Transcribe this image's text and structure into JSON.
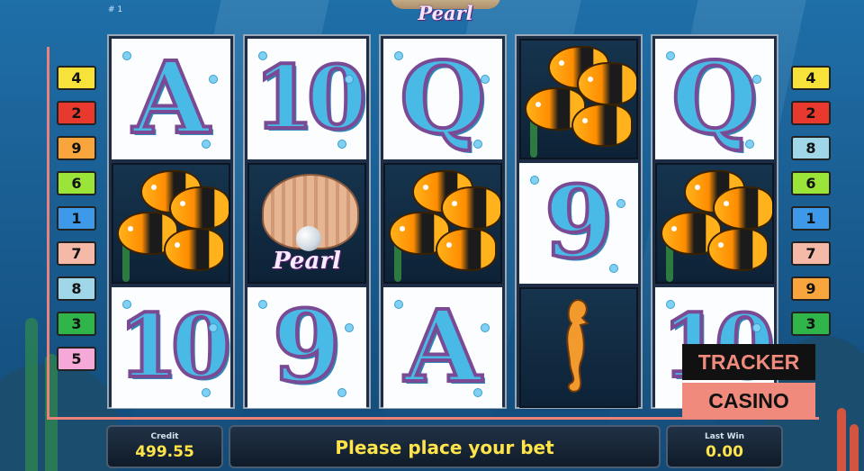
{
  "header": {
    "line_indicator": "# 1",
    "logo_text": "Pearl"
  },
  "paylines_left": [
    {
      "number": "4",
      "color": "#f7e23a"
    },
    {
      "number": "2",
      "color": "#e8392e"
    },
    {
      "number": "9",
      "color": "#f7a53c"
    },
    {
      "number": "6",
      "color": "#9be43a"
    },
    {
      "number": "1",
      "color": "#3e9ae8"
    },
    {
      "number": "7",
      "color": "#f5b9a8"
    },
    {
      "number": "8",
      "color": "#9fd6e8"
    },
    {
      "number": "3",
      "color": "#2fb54a"
    },
    {
      "number": "5",
      "color": "#f6a9d8"
    }
  ],
  "paylines_right": [
    {
      "number": "4",
      "color": "#f7e23a"
    },
    {
      "number": "2",
      "color": "#e8392e"
    },
    {
      "number": "8",
      "color": "#9fd6e8"
    },
    {
      "number": "6",
      "color": "#9be43a"
    },
    {
      "number": "1",
      "color": "#3e9ae8"
    },
    {
      "number": "7",
      "color": "#f5b9a8"
    },
    {
      "number": "9",
      "color": "#f7a53c"
    },
    {
      "number": "3",
      "color": "#2fb54a"
    }
  ],
  "reels": [
    [
      "A",
      "fish",
      "10"
    ],
    [
      "10",
      "pearl",
      "9"
    ],
    [
      "Q",
      "fish",
      "A"
    ],
    [
      "fish",
      "9",
      "seahorse"
    ],
    [
      "Q",
      "fish",
      "10"
    ]
  ],
  "symbols": {
    "pearl_label": "Pearl"
  },
  "bottom": {
    "credit_label": "Credit",
    "credit_value": "499.55",
    "message": "Please place your bet",
    "last_win_label": "Last Win",
    "last_win_value": "0.00"
  },
  "watermark": {
    "line1": "TRACKER",
    "line2": "CASINO",
    "line1_bg": "#111111",
    "line1_color": "#f08a7c",
    "line2_bg": "#f08a7c",
    "line2_color": "#111111"
  }
}
